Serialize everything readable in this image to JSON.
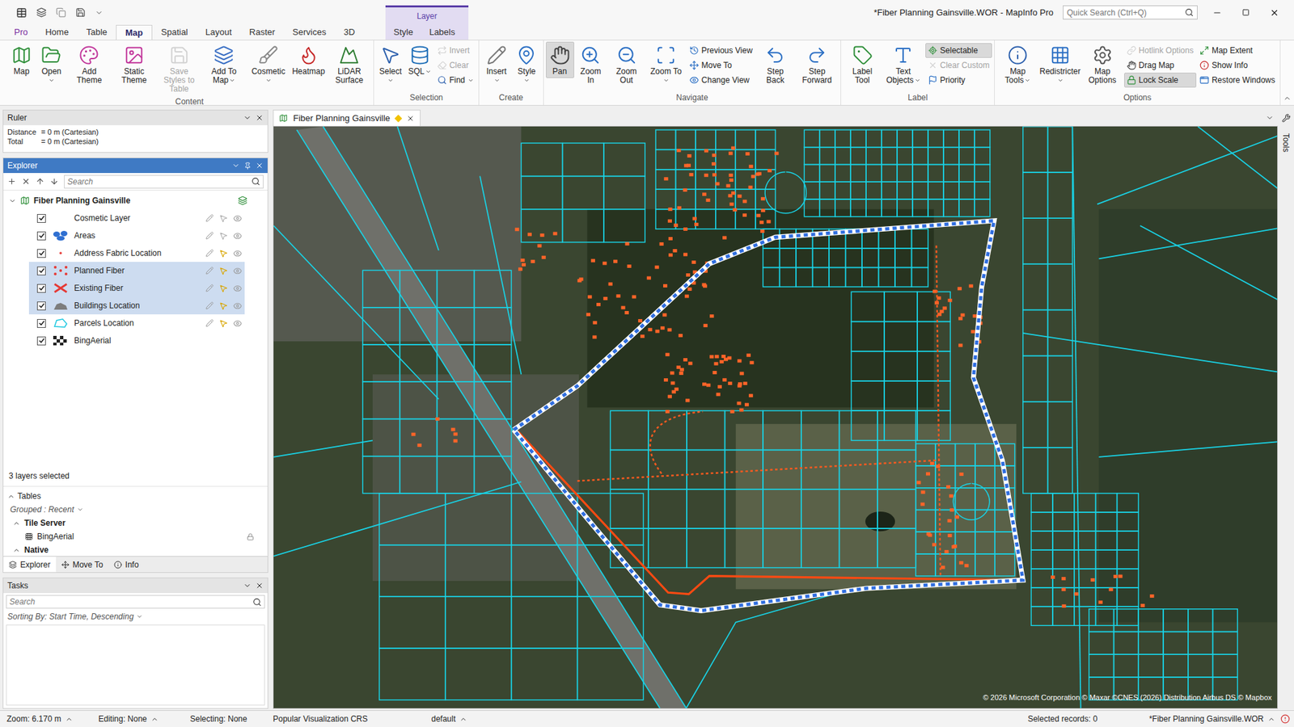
{
  "window": {
    "title": "*Fiber Planning Gainsville.WOR - MapInfo Pro",
    "search_placeholder": "Quick Search (Ctrl+Q)"
  },
  "ribbon": {
    "contextual_group": "Layer",
    "tabs": [
      {
        "label": "Pro",
        "selected": false,
        "contextual": false
      },
      {
        "label": "Home",
        "selected": false,
        "contextual": false
      },
      {
        "label": "Table",
        "selected": false,
        "contextual": false
      },
      {
        "label": "Map",
        "selected": true,
        "contextual": false
      },
      {
        "label": "Spatial",
        "selected": false,
        "contextual": false
      },
      {
        "label": "Layout",
        "selected": false,
        "contextual": false
      },
      {
        "label": "Raster",
        "selected": false,
        "contextual": false
      },
      {
        "label": "Services",
        "selected": false,
        "contextual": false
      },
      {
        "label": "3D",
        "selected": false,
        "contextual": false
      },
      {
        "label": "Style",
        "selected": false,
        "contextual": true
      },
      {
        "label": "Labels",
        "selected": false,
        "contextual": true
      }
    ],
    "groups": [
      {
        "label": "Content",
        "items": [
          {
            "label": "Map",
            "kind": "large",
            "disabled": false,
            "menu": false,
            "active": false
          },
          {
            "label": "Open",
            "kind": "large",
            "disabled": false,
            "menu": true,
            "active": false
          },
          {
            "label": "Add Theme",
            "kind": "large",
            "disabled": false,
            "menu": false,
            "active": false
          },
          {
            "label": "Static Theme",
            "kind": "large",
            "disabled": false,
            "menu": false,
            "active": false
          },
          {
            "label": "Save Styles to Table",
            "kind": "large",
            "disabled": true,
            "menu": false,
            "active": false
          },
          {
            "label": "Add To Map",
            "kind": "large",
            "disabled": false,
            "menu": true,
            "active": false
          },
          {
            "label": "Cosmetic",
            "kind": "large",
            "disabled": false,
            "menu": true,
            "active": false
          },
          {
            "label": "Heatmap",
            "kind": "large",
            "disabled": false,
            "menu": false,
            "active": false
          },
          {
            "label": "LiDAR Surface",
            "kind": "large",
            "disabled": false,
            "menu": false,
            "active": false
          }
        ]
      },
      {
        "label": "Selection",
        "items": [
          {
            "label": "Select",
            "kind": "large",
            "disabled": false,
            "menu": true,
            "active": false
          },
          {
            "label": "SQL",
            "kind": "large",
            "disabled": false,
            "menu": true,
            "active": false
          },
          {
            "label": "Invert",
            "kind": "small",
            "disabled": true,
            "menu": false,
            "active": false
          },
          {
            "label": "Clear",
            "kind": "small",
            "disabled": true,
            "menu": false,
            "active": false
          },
          {
            "label": "Find",
            "kind": "small",
            "disabled": false,
            "menu": true,
            "active": false
          }
        ]
      },
      {
        "label": "Create",
        "items": [
          {
            "label": "Insert",
            "kind": "large",
            "disabled": false,
            "menu": true,
            "active": false
          },
          {
            "label": "Style",
            "kind": "large",
            "disabled": false,
            "menu": true,
            "active": false
          }
        ]
      },
      {
        "label": "Navigate",
        "items": [
          {
            "label": "Pan",
            "kind": "large",
            "disabled": false,
            "menu": false,
            "active": true
          },
          {
            "label": "Zoom In",
            "kind": "large",
            "disabled": false,
            "menu": false,
            "active": false
          },
          {
            "label": "Zoom Out",
            "kind": "large",
            "disabled": false,
            "menu": false,
            "active": false
          },
          {
            "label": "Zoom To",
            "kind": "large",
            "disabled": false,
            "menu": true,
            "active": false
          },
          {
            "label": "Previous View",
            "kind": "small",
            "disabled": false,
            "menu": false,
            "active": false
          },
          {
            "label": "Move To",
            "kind": "small",
            "disabled": false,
            "menu": false,
            "active": false
          },
          {
            "label": "Change View",
            "kind": "small",
            "disabled": false,
            "menu": false,
            "active": false
          },
          {
            "label": "Step Back",
            "kind": "large",
            "disabled": false,
            "menu": false,
            "active": false
          },
          {
            "label": "Step Forward",
            "kind": "large",
            "disabled": false,
            "menu": false,
            "active": false
          }
        ]
      },
      {
        "label": "Label",
        "items": [
          {
            "label": "Label Tool",
            "kind": "large",
            "disabled": false,
            "menu": false,
            "active": false
          },
          {
            "label": "Text Objects",
            "kind": "large",
            "disabled": false,
            "menu": true,
            "active": false
          },
          {
            "label": "Selectable",
            "kind": "small",
            "disabled": false,
            "menu": false,
            "active": true
          },
          {
            "label": "Clear Custom",
            "kind": "small",
            "disabled": true,
            "menu": false,
            "active": false
          },
          {
            "label": "Priority",
            "kind": "small",
            "disabled": false,
            "menu": false,
            "active": false
          }
        ]
      },
      {
        "label": "Options",
        "items": [
          {
            "label": "Map Tools",
            "kind": "large",
            "disabled": false,
            "menu": true,
            "active": false
          },
          {
            "label": "Redistricter",
            "kind": "large",
            "disabled": false,
            "menu": true,
            "active": false
          },
          {
            "label": "Map Options",
            "kind": "large",
            "disabled": false,
            "menu": false,
            "active": false
          },
          {
            "label": "Hotlink Options",
            "kind": "small",
            "disabled": true,
            "menu": false,
            "active": false
          },
          {
            "label": "Drag Map",
            "kind": "small",
            "disabled": false,
            "menu": false,
            "active": false
          },
          {
            "label": "Lock Scale",
            "kind": "small",
            "disabled": false,
            "menu": false,
            "active": true
          },
          {
            "label": "Map Extent",
            "kind": "small",
            "disabled": false,
            "menu": false,
            "active": false
          },
          {
            "label": "Show Info",
            "kind": "small",
            "disabled": false,
            "menu": false,
            "active": false
          },
          {
            "label": "Restore Windows",
            "kind": "small",
            "disabled": false,
            "menu": false,
            "active": false
          }
        ]
      }
    ]
  },
  "ruler": {
    "title": "Ruler",
    "rows": [
      {
        "label": "Distance",
        "value": "= 0 m (Cartesian)"
      },
      {
        "label": "Total",
        "value": "= 0 m (Cartesian)"
      }
    ]
  },
  "explorer": {
    "title": "Explorer",
    "search_placeholder": "Search",
    "root": "Fiber Planning Gainsville",
    "layers": [
      {
        "name": "Cosmetic Layer",
        "checked": true,
        "selected": false,
        "has_tools": true,
        "selectable": false
      },
      {
        "name": "Areas",
        "checked": true,
        "selected": false,
        "has_tools": true,
        "selectable": false
      },
      {
        "name": "Address Fabric Location",
        "checked": true,
        "selected": false,
        "has_tools": true,
        "selectable": true
      },
      {
        "name": "Planned Fiber",
        "checked": true,
        "selected": true,
        "has_tools": true,
        "selectable": true
      },
      {
        "name": "Existing Fiber",
        "checked": true,
        "selected": true,
        "has_tools": true,
        "selectable": true
      },
      {
        "name": "Buildings Location",
        "checked": true,
        "selected": true,
        "has_tools": true,
        "selectable": true
      },
      {
        "name": "Parcels Location",
        "checked": true,
        "selected": false,
        "has_tools": true,
        "selectable": true
      },
      {
        "name": "BingAerial",
        "checked": true,
        "selected": false,
        "has_tools": false,
        "selectable": false
      }
    ],
    "selection_note": "3 layers selected",
    "tables": {
      "title": "Tables",
      "grouping": "Grouped : Recent",
      "groups": [
        {
          "label": "Tile Server",
          "items": [
            "BingAerial"
          ]
        },
        {
          "label": "Native",
          "items": []
        }
      ]
    },
    "bottom_tabs": [
      {
        "label": "Explorer",
        "selected": true
      },
      {
        "label": "Move To",
        "selected": false
      },
      {
        "label": "Info",
        "selected": false
      }
    ]
  },
  "tasks": {
    "title": "Tasks",
    "search_placeholder": "Search",
    "sorting": "Sorting By: Start Time, Descending"
  },
  "map": {
    "tab": "Fiber Planning Gainsville",
    "modified": true,
    "attribution": "© 2026 Microsoft Corporation © Maxar ©CNES (2026) Distribution Airbus DS © Mapbox",
    "side_tool": "Tools"
  },
  "status_bar": {
    "zoom": "Zoom: 6.170 m",
    "editing": "Editing: None",
    "selecting": "Selecting: None",
    "crs": "Popular Visualization CRS",
    "style": "default",
    "selected_records": "Selected records: 0",
    "workspace": "*Fiber Planning Gainsville.WOR"
  }
}
